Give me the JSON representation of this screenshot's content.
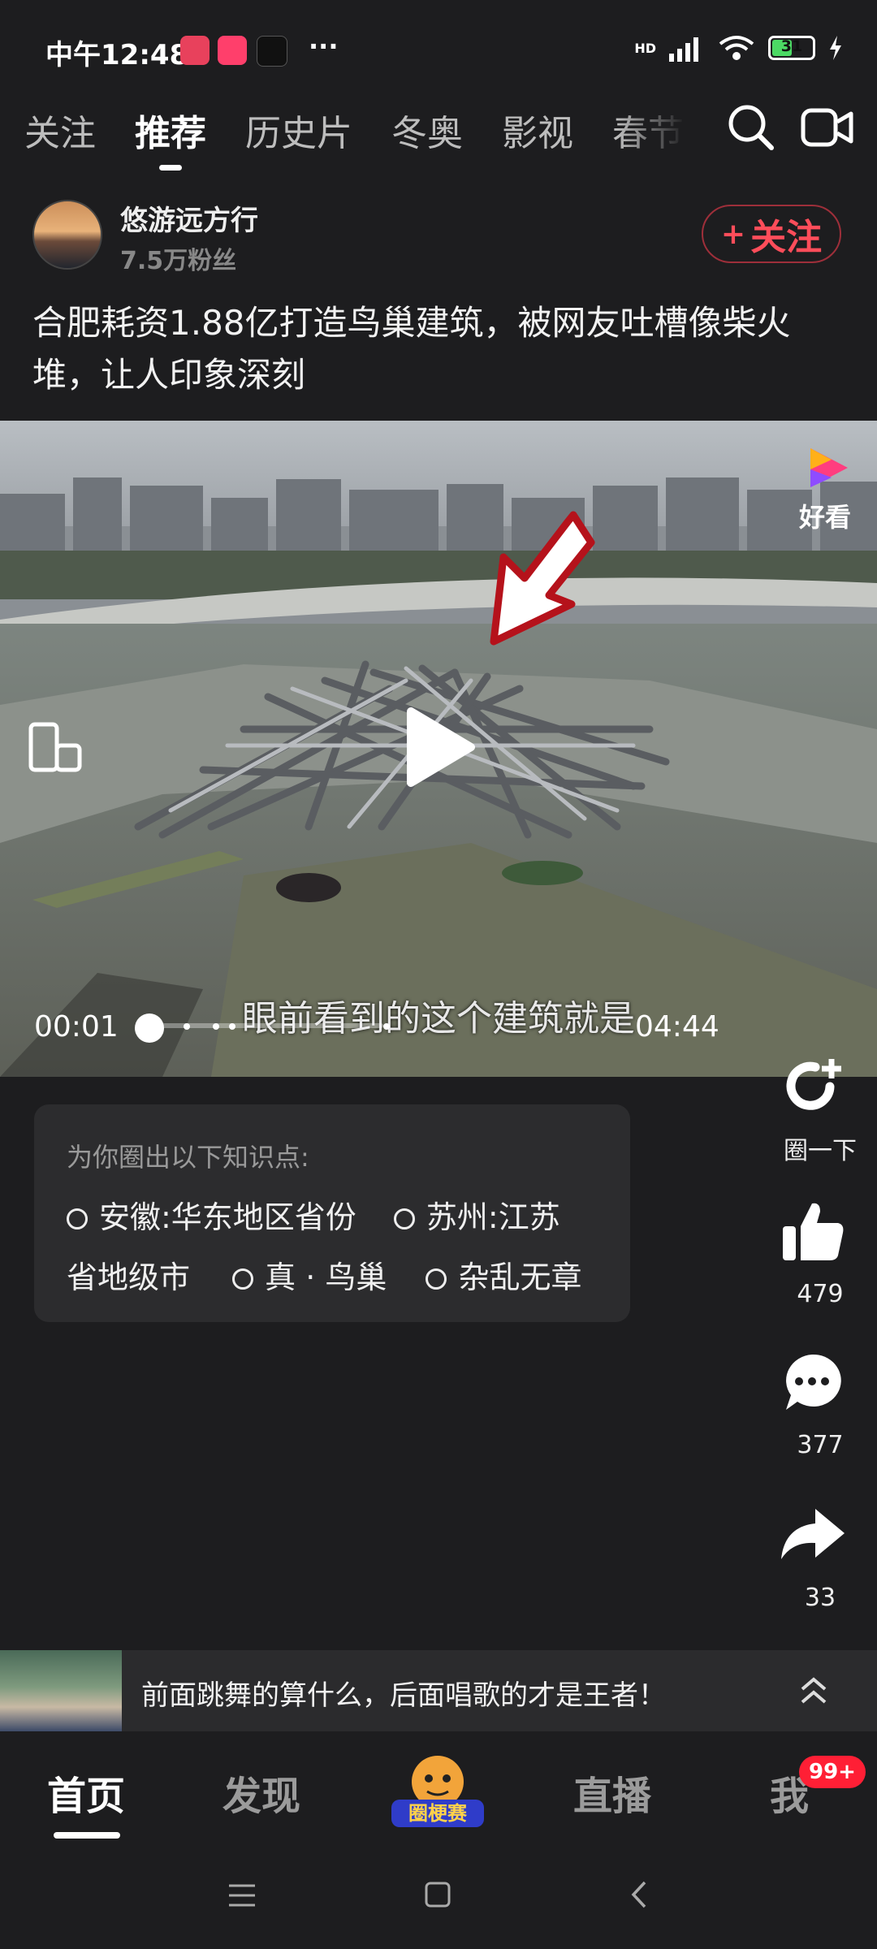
{
  "status": {
    "time": "中午12:48",
    "more": "···",
    "network": "HD",
    "battery": "31"
  },
  "tabs": [
    "关注",
    "推荐",
    "历史片",
    "冬奥",
    "影视",
    "春节"
  ],
  "author": {
    "name": "悠游远方行",
    "fans": "7.5万粉丝",
    "follow_label": "关注",
    "follow_prefix": "+"
  },
  "post": {
    "title": "合肥耗资1.88亿打造鸟巢建筑，被网友吐槽像柴火堆，让人印象深刻"
  },
  "video": {
    "subtitle": "眼前看到的这个建筑就是",
    "current_time": "00:01",
    "duration": "04:44",
    "progress": 0.0035,
    "watermark": "好看"
  },
  "actions": [
    {
      "icon": "circle-add-icon",
      "label": "圈一下"
    },
    {
      "icon": "like-icon",
      "label": "479"
    },
    {
      "icon": "comment-icon",
      "label": "377"
    },
    {
      "icon": "share-icon",
      "label": "33"
    }
  ],
  "knowledge": {
    "header": "为你圈出以下知识点:",
    "items": [
      "安徽:华东地区省份",
      "苏州:江苏省地级市",
      "真 · 鸟巢",
      "杂乱无章"
    ],
    "line2_prefix": "省地级市"
  },
  "banner": {
    "text": "前面跳舞的算什么，后面唱歌的才是王者！"
  },
  "bottom_nav": {
    "items": [
      "首页",
      "发现",
      "直播",
      "我"
    ],
    "badge": "99+",
    "center_logo": "圈梗赛"
  },
  "colors": {
    "accent": "#ff4d5a",
    "background": "#1d1d1f"
  }
}
